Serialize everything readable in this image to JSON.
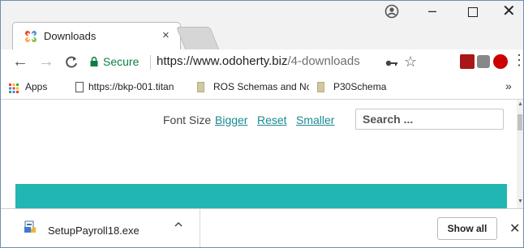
{
  "tab": {
    "title": "Downloads",
    "close": "×"
  },
  "window_controls": {
    "minimize": "–",
    "close": "✕"
  },
  "nav": {
    "back": "←",
    "forward": "→",
    "reload": "C"
  },
  "omnibox": {
    "secure_label": "Secure",
    "url_host": "https://www.odoherty.biz",
    "url_path": "/4-downloads"
  },
  "icons": {
    "key": "key-icon",
    "star": "star-icon",
    "menu": "⋮"
  },
  "bookmarks": {
    "apps": "Apps",
    "items": [
      "https://bkp-001.titan",
      "ROS Schemas and Nc",
      "P30Schema"
    ],
    "more": "»"
  },
  "page": {
    "font_size_label": "Font Size",
    "links": [
      "Bigger",
      "Reset",
      "Smaller"
    ],
    "search_placeholder": "Search ...",
    "accent_color": "#22b6b2"
  },
  "download_shelf": {
    "file_name": "SetupPayroll18.exe",
    "show_all": "Show all",
    "close": "✕"
  }
}
